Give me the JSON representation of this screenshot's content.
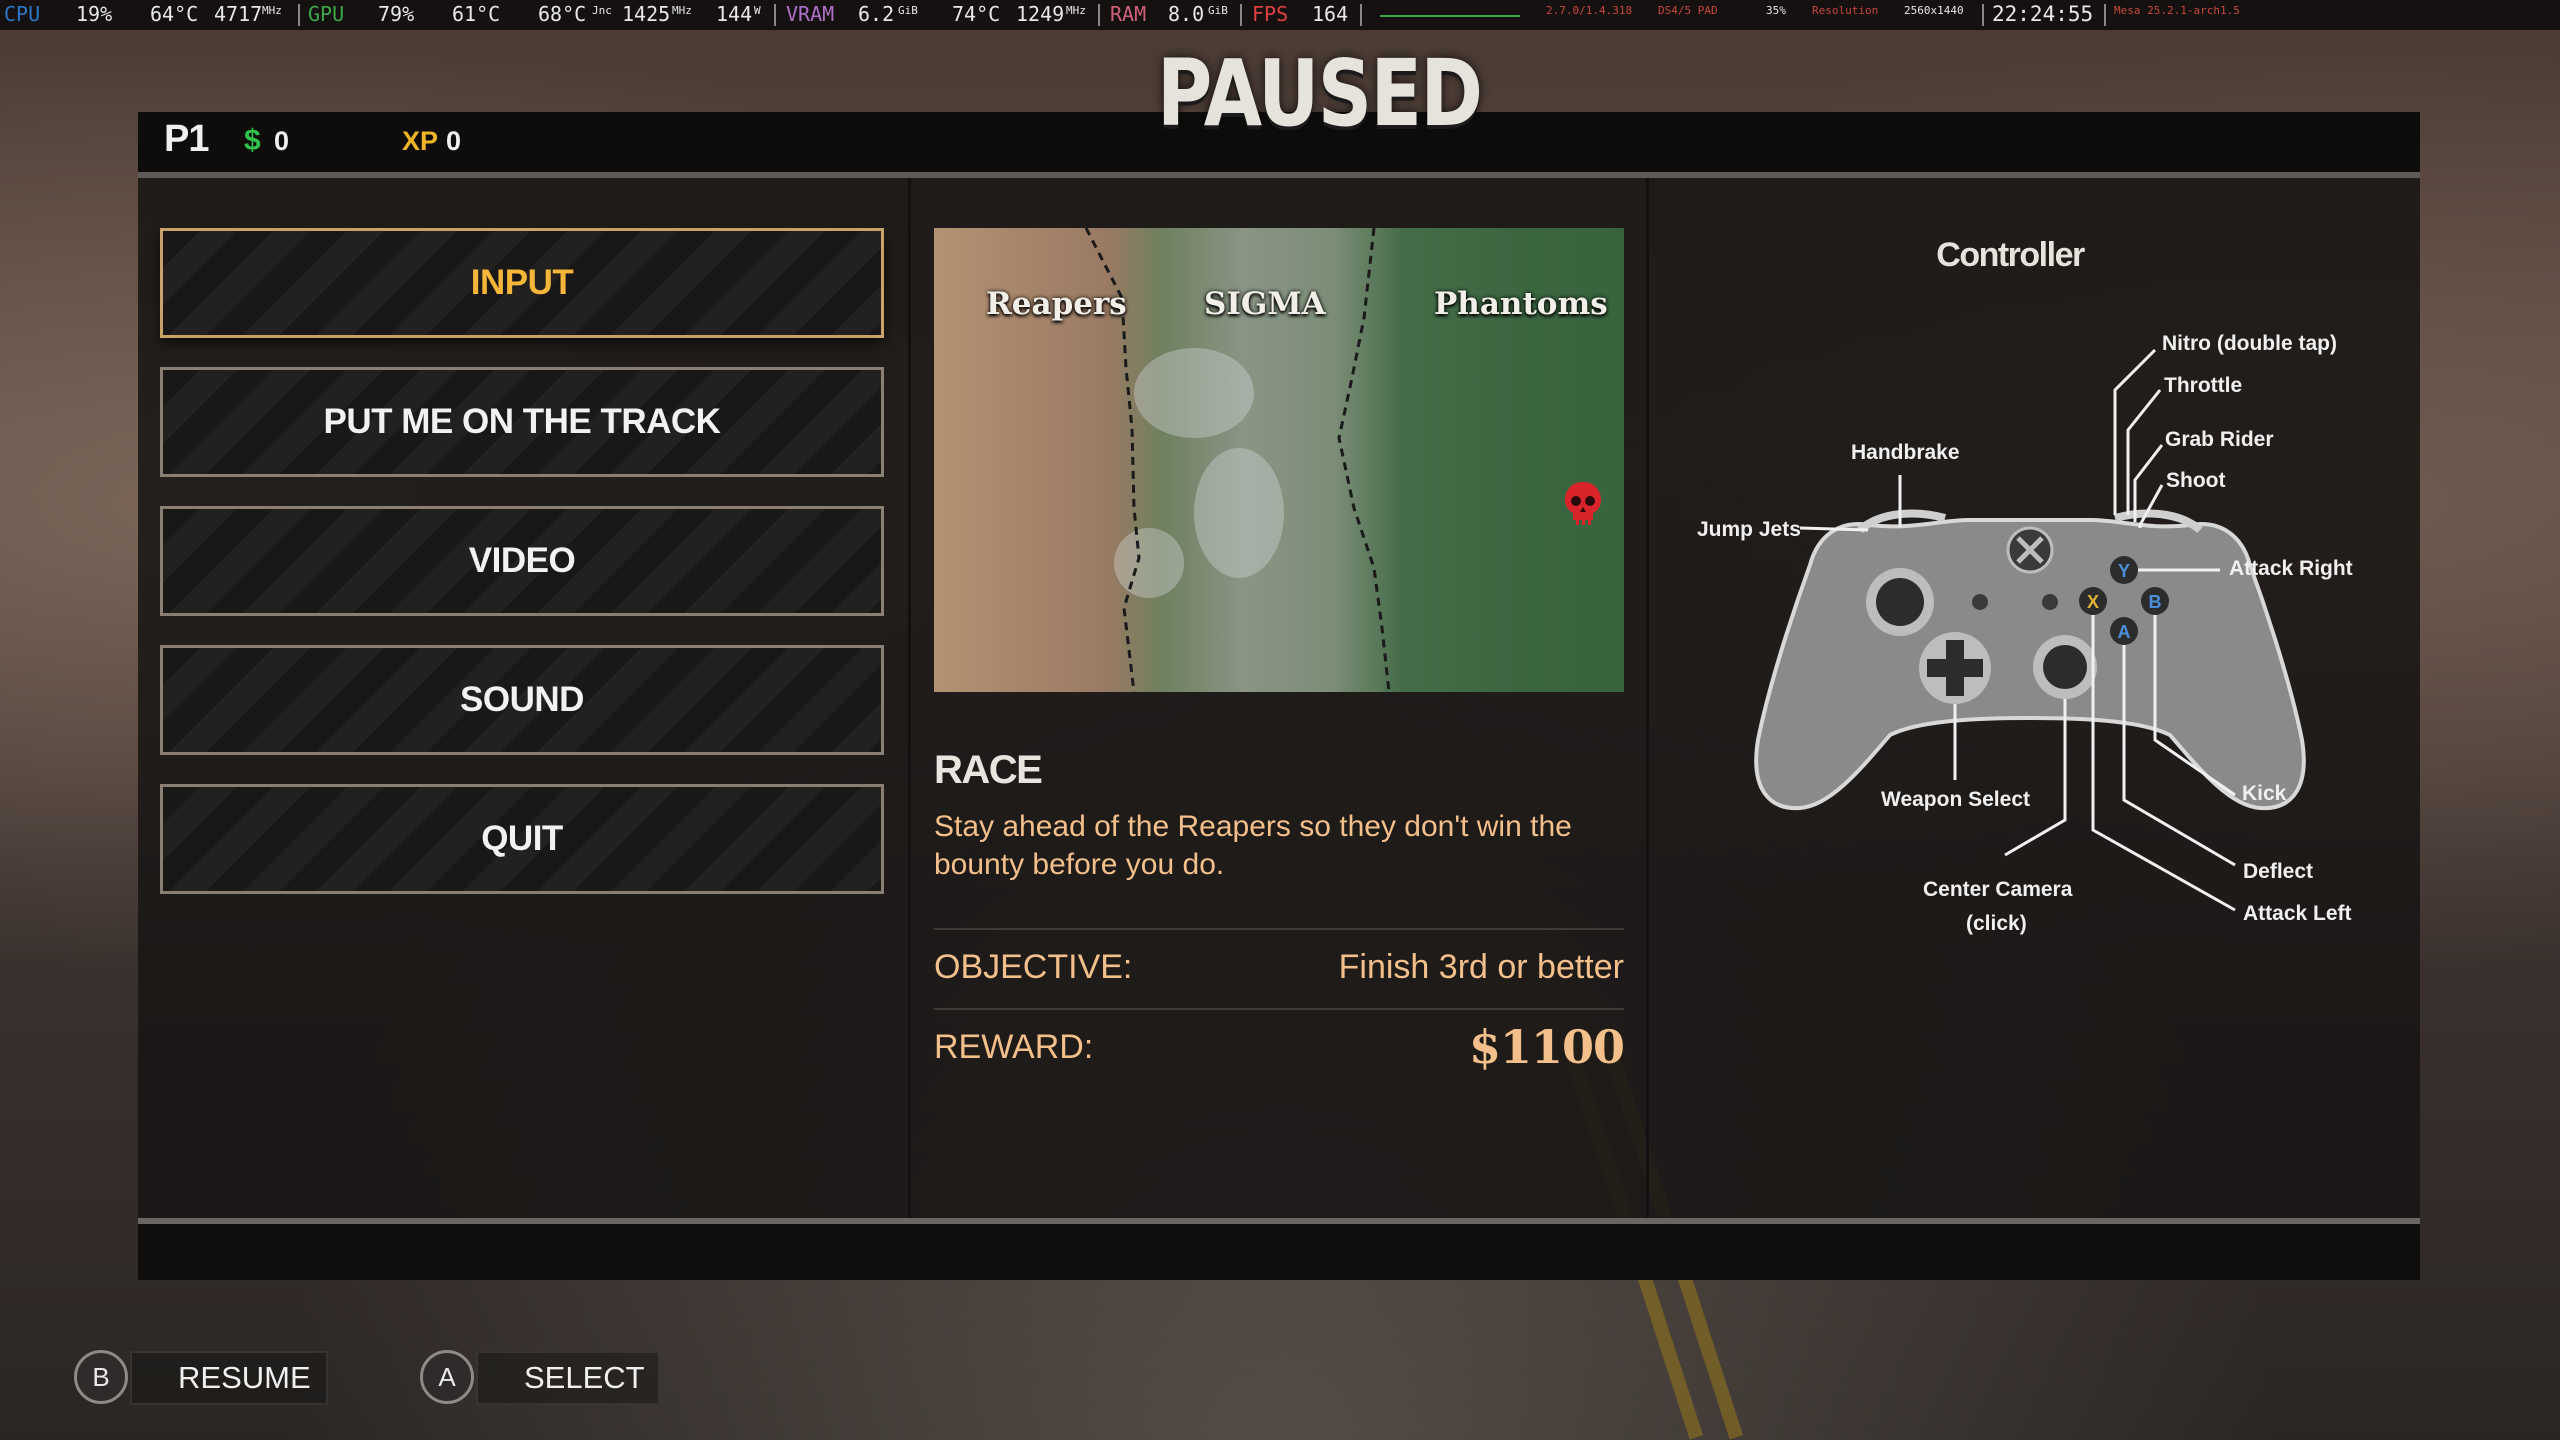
{
  "hud": {
    "cpu_label": "CPU",
    "cpu_load": "19%",
    "cpu_temp": "64°C",
    "cpu_clock": "4717",
    "cpu_clock_unit": "MHz",
    "gpu_label": "GPU",
    "gpu_load": "79%",
    "gpu_temp": "61°C",
    "gpu_junction": "68°C",
    "gpu_junction_unit": "Jnc",
    "gpu_clock": "1425",
    "gpu_clock_unit": "MHz",
    "gpu_power": "144",
    "gpu_power_unit": "W",
    "vram_label": "VRAM",
    "vram_value": "6.2",
    "vram_unit": "GiB",
    "mem_temp": "74°C",
    "mem_clock": "1249",
    "mem_clock_unit": "MHz",
    "ram_label": "RAM",
    "ram_value": "8.0",
    "ram_unit": "GiB",
    "fps_label": "FPS",
    "fps_value": "164",
    "mini1": "2.7.0/1.4.318",
    "mini2": "DS4/5 PAD",
    "mini3": "35%",
    "mini4": "Resolution",
    "mini5": "2560x1440",
    "clock": "22:24:55",
    "mini6": "Mesa 25.2.1-arch1.5"
  },
  "title": "PAUSED",
  "player": {
    "id": "P1",
    "cash_symbol": "$",
    "cash": "0",
    "xp_label": "XP",
    "xp": "0"
  },
  "menu": [
    {
      "label": "INPUT",
      "active": true
    },
    {
      "label": "PUT ME ON THE TRACK",
      "active": false
    },
    {
      "label": "VIDEO",
      "active": false
    },
    {
      "label": "SOUND",
      "active": false
    },
    {
      "label": "QUIT",
      "active": false
    }
  ],
  "map": {
    "factions": [
      "Reapers",
      "SIGMA",
      "Phantoms"
    ]
  },
  "event": {
    "type": "RACE",
    "description": "Stay ahead of the Reapers so they don't win the bounty before you do.",
    "objective_label": "OBJECTIVE:",
    "objective_value": "Finish 3rd or better",
    "reward_label": "REWARD:",
    "reward_value": "$1100"
  },
  "controller": {
    "title": "Controller",
    "labels": {
      "nitro": "Nitro (double tap)",
      "throttle": "Throttle",
      "grab_rider": "Grab Rider",
      "shoot": "Shoot",
      "handbrake": "Handbrake",
      "jump_jets": "Jump Jets",
      "attack_right": "Attack Right",
      "weapon_select": "Weapon Select",
      "kick": "Kick",
      "deflect": "Deflect",
      "attack_left": "Attack Left",
      "center_camera": "Center Camera",
      "center_camera_sub": "(click)"
    },
    "face_buttons": {
      "y": "Y",
      "b": "B",
      "x": "X",
      "a": "A"
    },
    "face_colors": {
      "y": "#4a8fd8",
      "b": "#4a8fd8",
      "x": "#e0b030",
      "a": "#4a8fd8"
    }
  },
  "prompts": {
    "resume_button": "B",
    "resume_label": "RESUME",
    "select_button": "A",
    "select_label": "SELECT"
  },
  "colors": {
    "accent_orange": "#f5b63a",
    "text_peach": "#f3bf8a",
    "cash_green": "#31c24a",
    "xp_gold": "#f0b428",
    "skull_red": "#d8242a"
  }
}
